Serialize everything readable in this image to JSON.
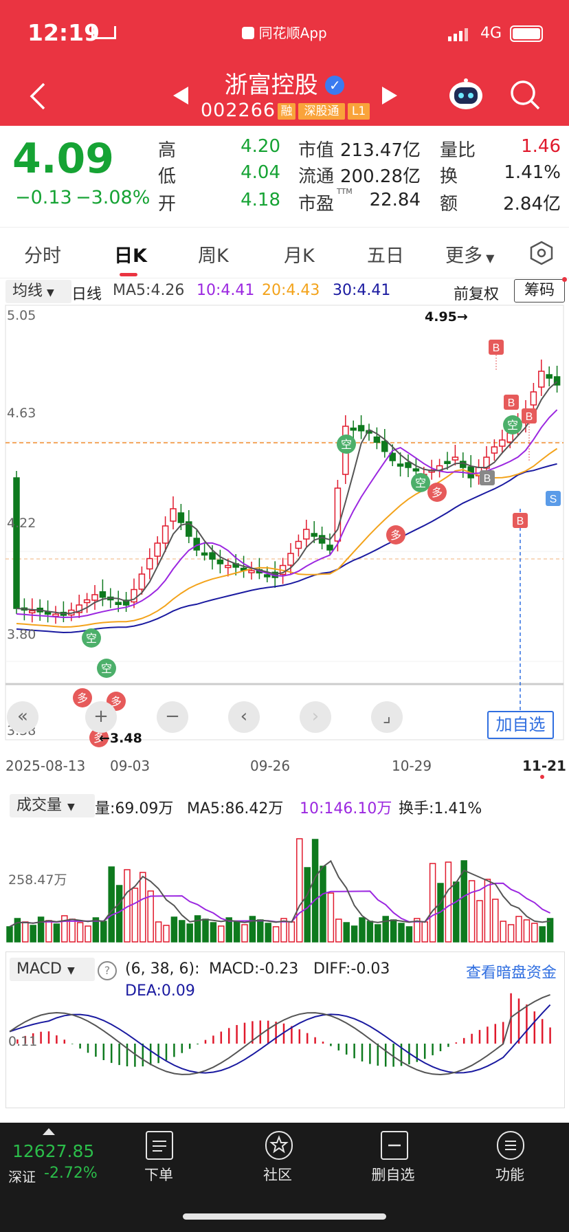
{
  "status_bar": {
    "time": "12:19",
    "app": "同花顺App",
    "network": "4G"
  },
  "header": {
    "title": "浙富控股",
    "code": "002266",
    "tags": [
      "融",
      "深股通",
      "L1"
    ]
  },
  "quote": {
    "price": "4.09",
    "change": "−0.13",
    "change_pct": "−3.08%",
    "items": [
      {
        "label": "高",
        "value": "4.20",
        "tone": "grn"
      },
      {
        "label": "低",
        "value": "4.04",
        "tone": "grn"
      },
      {
        "label": "开",
        "value": "4.18",
        "tone": "grn"
      },
      {
        "label": "市值",
        "value": "213.47亿",
        "tone": "blk"
      },
      {
        "label": "流通",
        "value": "200.28亿",
        "tone": "blk"
      },
      {
        "label": "市盈",
        "value": "22.84",
        "tone": "blk",
        "sup": "TTM"
      },
      {
        "label": "量比",
        "value": "1.46",
        "tone": "red"
      },
      {
        "label": "换",
        "value": "1.41%",
        "tone": "blk"
      },
      {
        "label": "额",
        "value": "2.84亿",
        "tone": "blk"
      }
    ]
  },
  "tabs": [
    "分时",
    "日K",
    "周K",
    "月K",
    "五日",
    "更多"
  ],
  "active_tab": "日K",
  "kline": {
    "indicator_select": "均线",
    "period_label": "日线",
    "ma": {
      "ma5": "MA5:4.26",
      "ma10": "10:4.41",
      "ma20": "20:4.43",
      "ma30": "30:4.41"
    },
    "adjust": "前复权",
    "chip_button": "筹码",
    "y_ticks": [
      "5.05",
      "4.63",
      "4.22",
      "3.80",
      "3.38"
    ],
    "high_annot": "4.95→",
    "low_annot": "←3.48",
    "dates": [
      "2025-08-13",
      "09-03",
      "09-26",
      "10-29",
      "11-21"
    ],
    "add_button": "加自选",
    "signal_labels": {
      "buy": "B",
      "sell": "S",
      "long": "多",
      "short": "空"
    },
    "colors": {
      "up": "#e0192c",
      "down": "#0e7a1e",
      "ma5": "#555555",
      "ma10": "#9b27e0",
      "ma20": "#f3a31b",
      "ma30": "#1a1aa0"
    }
  },
  "volume": {
    "select": "成交量",
    "vol": "量:69.09万",
    "ma5": "MA5:86.42万",
    "ma10": "10:146.10万",
    "turnover": "换手:1.41%",
    "axis": "258.47万"
  },
  "macd": {
    "select": "MACD",
    "help": "?",
    "params": "(6, 38, 6):",
    "macd": "MACD:-0.23",
    "diff": "DIFF:-0.03",
    "dea": "DEA:0.09",
    "link": "查看暗盘资金",
    "axis": "0.11"
  },
  "bottom_nav": {
    "index_value": "12627.85",
    "index_name": "深证",
    "index_change": "-2.72%",
    "items": [
      "下单",
      "社区",
      "删自选",
      "功能"
    ]
  }
}
